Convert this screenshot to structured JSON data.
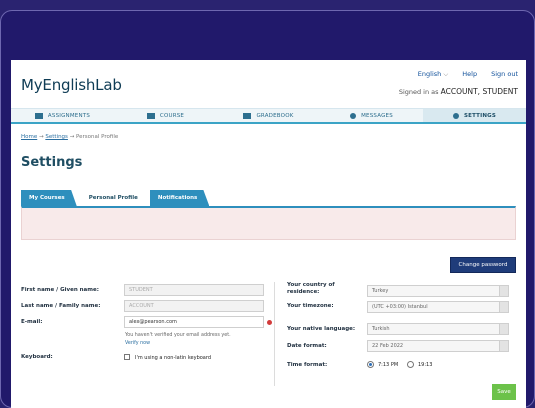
{
  "app": {
    "logo": "MyEnglishLab",
    "language": "English",
    "help": "Help",
    "sign_out": "Sign out",
    "signed_in_prefix": "Signed in as",
    "signed_in_user": "ACCOUNT, STUDENT"
  },
  "nav": {
    "tabs": [
      {
        "label": "ASSIGNMENTS",
        "icon": "assignments-icon"
      },
      {
        "label": "COURSE",
        "icon": "course-icon"
      },
      {
        "label": "GRADEBOOK",
        "icon": "gradebook-icon"
      },
      {
        "label": "MESSAGES",
        "icon": "messages-icon"
      },
      {
        "label": "SETTINGS",
        "icon": "gear-icon",
        "active": true
      }
    ]
  },
  "breadcrumb": {
    "home": "Home",
    "settings": "Settings",
    "current": "Personal Profile",
    "sep": "→"
  },
  "page": {
    "title": "Settings"
  },
  "subtabs": {
    "my_courses": "My Courses",
    "personal_profile": "Personal Profile",
    "notifications": "Notifications"
  },
  "form": {
    "change_password": "Change password",
    "first_name_label": "First name / Given name:",
    "first_name_value": "STUDENT",
    "last_name_label": "Last name / Family name:",
    "last_name_value": "ACCOUNT",
    "email_label": "E-mail:",
    "email_value": "alex@pearson.com",
    "email_note": "You haven't verified your email address yet.",
    "verify_now": "Verify now",
    "keyboard_label": "Keyboard:",
    "keyboard_option": "I'm using a non-latin keyboard",
    "country_label": "Your country of residence:",
    "country_value": "Turkey",
    "timezone_label": "Your timezone:",
    "timezone_value": "(UTC +03:00) Istanbul",
    "native_lang_label": "Your native language:",
    "native_lang_value": "Turkish",
    "date_format_label": "Date format:",
    "date_format_value": "22 Feb 2022",
    "time_format_label": "Time format:",
    "time_12": "7:13 PM",
    "time_24": "19:13",
    "save": "Save"
  },
  "colors": {
    "accent": "#2e8fbd",
    "dark_button": "#1f3c7a",
    "save_green": "#6cc24a",
    "frame": "#21196b"
  }
}
